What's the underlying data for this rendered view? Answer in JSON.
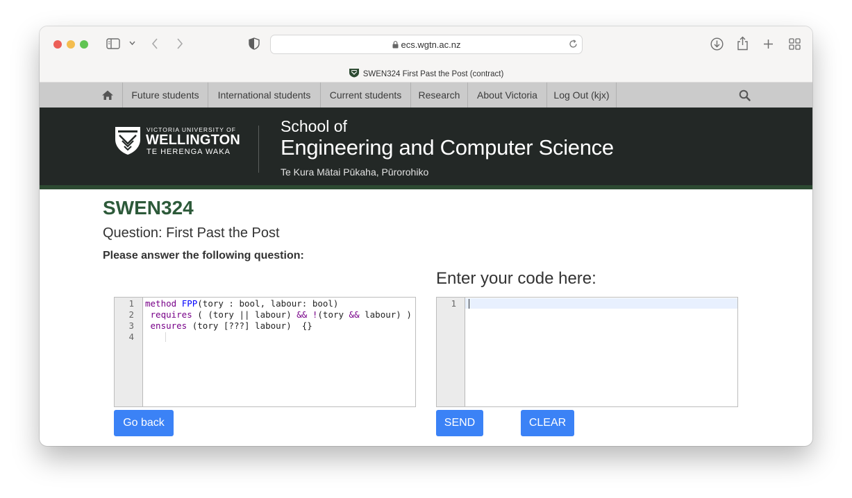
{
  "browser": {
    "url": "ecs.wgtn.ac.nz",
    "tab_title": "SWEN324 First Past the Post (contract)"
  },
  "nav": {
    "items": [
      "Future students",
      "International students",
      "Current students",
      "Research",
      "About Victoria",
      "Log Out (kjx)"
    ]
  },
  "banner": {
    "uni_small": "VICTORIA UNIVERSITY OF",
    "uni_big": "WELLINGTON",
    "uni_maori": "TE HERENGA WAKA",
    "school_of": "School of",
    "school_name": "Engineering and Computer Science",
    "school_maori": "Te Kura Mātai Pūkaha, Pūrorohiko"
  },
  "page": {
    "course": "SWEN324",
    "question": "Question: First Past the Post",
    "instruction": "Please answer the following question:",
    "enter_code": "Enter your code here:"
  },
  "question_editor": {
    "line_numbers": [
      "1",
      "2",
      "3",
      "4"
    ],
    "lines": [
      [
        {
          "t": "method",
          "c": "kw"
        },
        {
          "t": " "
        },
        {
          "t": "FPP",
          "c": "def"
        },
        {
          "t": "(tory : bool, labour: bool)"
        }
      ],
      [
        {
          "t": " "
        },
        {
          "t": "requires",
          "c": "kw"
        },
        {
          "t": " ( (tory || labour) "
        },
        {
          "t": "&&",
          "c": "kw"
        },
        {
          "t": " "
        },
        {
          "t": "!",
          "c": "kw"
        },
        {
          "t": "(tory "
        },
        {
          "t": "&&",
          "c": "kw"
        },
        {
          "t": " labour) )"
        }
      ],
      [
        {
          "t": " "
        },
        {
          "t": "ensures",
          "c": "kw"
        },
        {
          "t": " (tory [???] labour)  {}"
        }
      ],
      []
    ]
  },
  "answer_editor": {
    "line_numbers": [
      "1"
    ],
    "value": ""
  },
  "buttons": {
    "go_back": "Go back",
    "send": "SEND",
    "clear": "CLEAR"
  }
}
